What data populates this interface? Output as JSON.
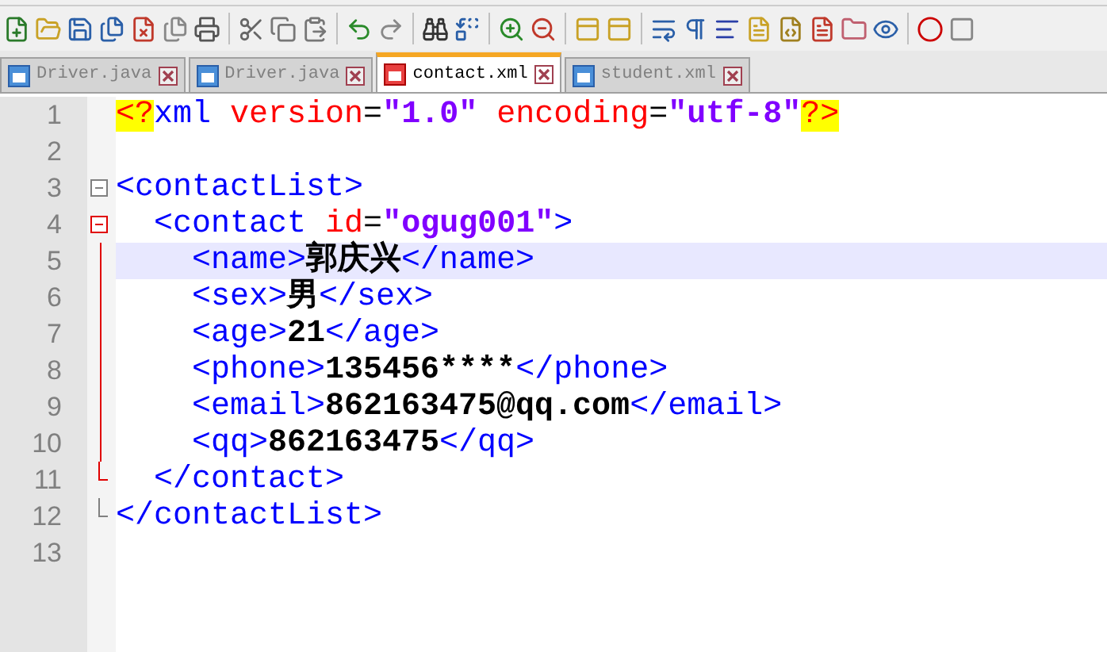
{
  "tabs": [
    {
      "label": "Driver.java",
      "selected": false,
      "modified": false
    },
    {
      "label": "Driver.java",
      "selected": false,
      "modified": false
    },
    {
      "label": "contact.xml",
      "selected": true,
      "modified": true
    },
    {
      "label": "student.xml",
      "selected": false,
      "modified": false
    }
  ],
  "editor": {
    "lines": [
      {
        "number": "1",
        "selected": false,
        "kind": "plain",
        "tokens": [
          {
            "kind": "pi",
            "text": "<?"
          },
          {
            "kind": "tag",
            "text": "xml "
          },
          {
            "kind": "attr",
            "text": "version"
          },
          {
            "kind": "punct",
            "text": "="
          },
          {
            "kind": "value",
            "text": "\"1.0\" "
          },
          {
            "kind": "attr",
            "text": "encoding"
          },
          {
            "kind": "punct",
            "text": "="
          },
          {
            "kind": "value",
            "text": "\"utf-8\""
          },
          {
            "kind": "pi",
            "text": "?>"
          }
        ]
      },
      {
        "number": "2",
        "selected": false,
        "kind": "plain"
      },
      {
        "number": "3",
        "selected": false,
        "kind": "opener",
        "tokens": [
          {
            "kind": "tag",
            "text": "<contactList>"
          }
        ]
      },
      {
        "number": "4",
        "selected": false,
        "kind": "opener",
        "tokens": [
          {
            "kind": "tag",
            "text": "  <contact "
          },
          {
            "kind": "attr",
            "text": "id"
          },
          {
            "kind": "punct",
            "text": "="
          },
          {
            "kind": "value",
            "text": "\"ogug001\""
          },
          {
            "kind": "tag",
            "text": ">"
          }
        ]
      },
      {
        "number": "5",
        "selected": true,
        "kind": "body",
        "tokens": [
          {
            "kind": "tag",
            "text": "    <name>"
          },
          {
            "kind": "text",
            "text": "郭庆兴"
          },
          {
            "kind": "tag",
            "text": "</name>"
          }
        ]
      },
      {
        "number": "6",
        "selected": false,
        "kind": "body",
        "tokens": [
          {
            "kind": "tag",
            "text": "    <sex>"
          },
          {
            "kind": "text",
            "text": "男"
          },
          {
            "kind": "tag",
            "text": "</sex>"
          }
        ]
      },
      {
        "number": "7",
        "selected": false,
        "kind": "body",
        "tokens": [
          {
            "kind": "tag",
            "text": "    <age>"
          },
          {
            "kind": "text",
            "text": "21"
          },
          {
            "kind": "tag",
            "text": "</age>"
          }
        ]
      },
      {
        "number": "8",
        "selected": false,
        "kind": "body",
        "tokens": [
          {
            "kind": "tag",
            "text": "    <phone>"
          },
          {
            "kind": "text",
            "text": "135456****"
          },
          {
            "kind": "tag",
            "text": "</phone>"
          }
        ]
      },
      {
        "number": "9",
        "selected": false,
        "kind": "body",
        "tokens": [
          {
            "kind": "tag",
            "text": "    <email>"
          },
          {
            "kind": "text",
            "text": "862163475@qq.com"
          },
          {
            "kind": "tag",
            "text": "</email>"
          }
        ]
      },
      {
        "number": "10",
        "selected": false,
        "kind": "body",
        "tokens": [
          {
            "kind": "tag",
            "text": "    <qq>"
          },
          {
            "kind": "text",
            "text": "862163475"
          },
          {
            "kind": "tag",
            "text": "</qq>"
          }
        ]
      },
      {
        "number": "11",
        "selected": false,
        "kind": "closer",
        "tokens": [
          {
            "kind": "tag",
            "text": "  </contact>"
          }
        ]
      },
      {
        "number": "12",
        "selected": false,
        "kind": "closer",
        "tokens": [
          {
            "kind": "tag",
            "text": "</contactList>"
          }
        ]
      },
      {
        "number": "13",
        "selected": false,
        "kind": "plain"
      }
    ]
  }
}
